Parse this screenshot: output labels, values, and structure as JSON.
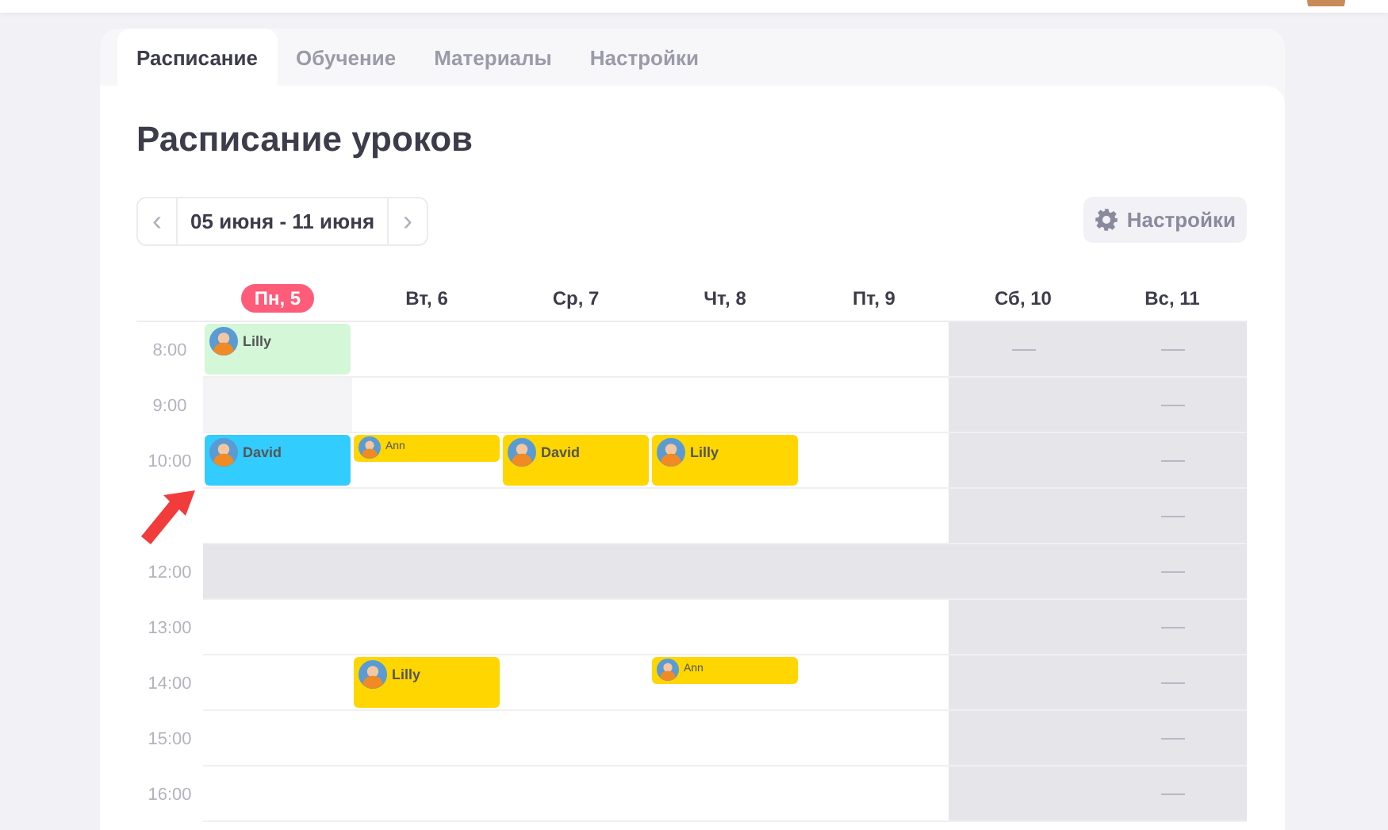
{
  "tabs": [
    {
      "label": "Расписание",
      "selected": true
    },
    {
      "label": "Обучение",
      "selected": false
    },
    {
      "label": "Материалы",
      "selected": false
    },
    {
      "label": "Настройки",
      "selected": false
    }
  ],
  "title": "Расписание уроков",
  "week_nav": {
    "prev": "‹",
    "range": "05 июня - 11 июня",
    "next": "›"
  },
  "settings_button": "Настройки",
  "days": [
    {
      "label": "Пн, 5",
      "selected": true
    },
    {
      "label": "Вт, 6",
      "selected": false
    },
    {
      "label": "Ср, 7",
      "selected": false
    },
    {
      "label": "Чт, 8",
      "selected": false
    },
    {
      "label": "Пт, 9",
      "selected": false
    },
    {
      "label": "Сб, 10",
      "selected": false
    },
    {
      "label": "Вс, 11",
      "selected": false
    }
  ],
  "rows": [
    {
      "time": "8:00",
      "cells": [
        {
          "kind": "free",
          "event": {
            "name": "Lilly",
            "color": "#d4f7d8",
            "kind": "long"
          }
        },
        {
          "kind": "free"
        },
        {
          "kind": "free"
        },
        {
          "kind": "free"
        },
        {
          "kind": "free"
        },
        {
          "kind": "off",
          "dash": true
        },
        {
          "kind": "off",
          "dash": true
        }
      ]
    },
    {
      "time": "9:00",
      "cells": [
        {
          "kind": "muted"
        },
        {
          "kind": "free"
        },
        {
          "kind": "free"
        },
        {
          "kind": "free"
        },
        {
          "kind": "free"
        },
        {
          "kind": "off"
        },
        {
          "kind": "off",
          "dash": true
        }
      ]
    },
    {
      "time": "10:00",
      "cells": [
        {
          "kind": "free",
          "event": {
            "name": "David",
            "color": "#33ccff",
            "kind": "long"
          }
        },
        {
          "kind": "free",
          "event": {
            "name": "Ann",
            "color": "#ffd600",
            "kind": "short"
          }
        },
        {
          "kind": "free",
          "event": {
            "name": "David",
            "color": "#ffd600",
            "kind": "long"
          }
        },
        {
          "kind": "free",
          "event": {
            "name": "Lilly",
            "color": "#ffd600",
            "kind": "long"
          }
        },
        {
          "kind": "free"
        },
        {
          "kind": "off"
        },
        {
          "kind": "off",
          "dash": true
        }
      ]
    },
    {
      "cells": [
        {
          "kind": "free"
        },
        {
          "kind": "free"
        },
        {
          "kind": "free"
        },
        {
          "kind": "free"
        },
        {
          "kind": "free"
        },
        {
          "kind": "off"
        },
        {
          "kind": "off",
          "dash": true
        }
      ]
    },
    {
      "time": "12:00",
      "cells": [
        {
          "kind": "off"
        },
        {
          "kind": "off"
        },
        {
          "kind": "off"
        },
        {
          "kind": "off"
        },
        {
          "kind": "off"
        },
        {
          "kind": "off"
        },
        {
          "kind": "off",
          "dash": true
        }
      ]
    },
    {
      "time": "13:00",
      "cells": [
        {
          "kind": "free"
        },
        {
          "kind": "free"
        },
        {
          "kind": "free"
        },
        {
          "kind": "free"
        },
        {
          "kind": "free"
        },
        {
          "kind": "off"
        },
        {
          "kind": "off",
          "dash": true
        }
      ]
    },
    {
      "time": "14:00",
      "cells": [
        {
          "kind": "free"
        },
        {
          "kind": "free",
          "event": {
            "name": "Lilly",
            "color": "#ffd600",
            "kind": "long"
          }
        },
        {
          "kind": "free"
        },
        {
          "kind": "free",
          "event": {
            "name": "Ann",
            "color": "#ffd600",
            "kind": "short"
          }
        },
        {
          "kind": "free"
        },
        {
          "kind": "off"
        },
        {
          "kind": "off",
          "dash": true
        }
      ]
    },
    {
      "time": "15:00",
      "cells": [
        {
          "kind": "free"
        },
        {
          "kind": "free"
        },
        {
          "kind": "free"
        },
        {
          "kind": "free"
        },
        {
          "kind": "free"
        },
        {
          "kind": "off"
        },
        {
          "kind": "off",
          "dash": true
        }
      ]
    },
    {
      "time": "16:00",
      "cells": [
        {
          "kind": "free"
        },
        {
          "kind": "free"
        },
        {
          "kind": "free"
        },
        {
          "kind": "free"
        },
        {
          "kind": "free"
        },
        {
          "kind": "off"
        },
        {
          "kind": "off",
          "dash": true
        }
      ]
    }
  ]
}
